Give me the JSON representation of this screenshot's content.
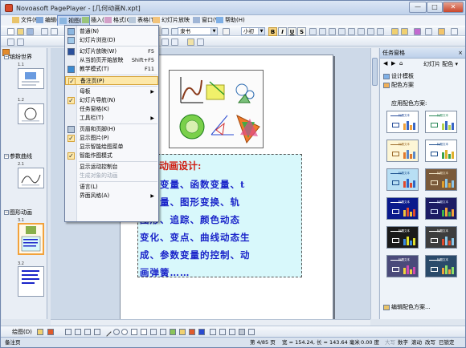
{
  "window": {
    "title": "Novoasoft PagePlayer - [几何动画N.xpt]",
    "minimize": "—",
    "maximize": "□",
    "close": "✕"
  },
  "menubar": [
    "文件(F)",
    "编辑(E)",
    "视图(V)",
    "插入(I)",
    "格式(O)",
    "表格(T)",
    "幻灯片放映",
    "窗口(W)",
    "帮助(H)"
  ],
  "format_bar": {
    "font_name": "隶书",
    "font_size": "小初",
    "bold": "B",
    "italic": "I",
    "underline": "U",
    "shadow": "S"
  },
  "view_menu": [
    {
      "label": "普通(N)",
      "icon": "normal-view-icon"
    },
    {
      "label": "幻灯片浏览(D)",
      "icon": "slide-sorter-icon"
    },
    {
      "label": "幻灯片放映(W)",
      "shortcut": "F5",
      "icon": "slideshow-icon"
    },
    {
      "label": "从当前页开始放映",
      "shortcut": "Shift+F5"
    },
    {
      "label": "教学模式(T)",
      "shortcut": "F11",
      "icon": "teaching-mode-icon"
    },
    {
      "label": "备注页(P)",
      "checked": true,
      "highlighted": true
    },
    {
      "label": "母板",
      "submenu": true
    },
    {
      "label": "幻灯片导航(N)",
      "checked": true
    },
    {
      "label": "任务窗格(K)"
    },
    {
      "label": "工具栏(T)",
      "submenu": true
    },
    {
      "label": "页眉和页脚(H)",
      "icon": "header-footer-icon"
    },
    {
      "label": "显示图片(P)",
      "checked": true
    },
    {
      "label": "显示智能绘图菜单"
    },
    {
      "label": "智能作图模式",
      "checked": true
    },
    {
      "label": "显示运动控制台"
    },
    {
      "label": "生成对象的动画",
      "disabled": true
    },
    {
      "label": "语言(L)"
    },
    {
      "label": "界面风格(A)",
      "submenu": true
    }
  ],
  "outline": {
    "sections": [
      {
        "label": "缤纷世界",
        "toggle": "−"
      },
      {
        "label": "参数曲线",
        "toggle": "−"
      },
      {
        "label": "图形动画",
        "toggle": "−"
      }
    ],
    "slides": [
      "1.1",
      "1.2",
      "2.1",
      "3.1",
      "3.2"
    ]
  },
  "slide": {
    "title": "形动画设计:",
    "lines": [
      "定义变量、函数变量、t",
      "形度量、图形变换、轨",
      "图形、追踪、颜色动态",
      "变化、变点、曲线动态生",
      "成、参数变量的控制、动",
      "画弹簧……"
    ]
  },
  "task_pane": {
    "title": "任务窗格",
    "close": "×",
    "current": "幻灯片 配色",
    "links": [
      "设计模板",
      "配色方案"
    ],
    "section_label": "应用配色方案:",
    "scheme_title": "标题文本",
    "schemes": [
      {
        "bg": "#ffffff",
        "accent": "#2a4f9b",
        "bar1": "#f2a23b",
        "bar2": "#3a67c5"
      },
      {
        "bg": "#ffffff",
        "accent": "#2d8a5b",
        "bar1": "#b5d44d",
        "bar2": "#3a67c5"
      },
      {
        "bg": "#fdf6d6",
        "accent": "#9b6a2a",
        "bar1": "#e07a2d",
        "bar2": "#5a88c9"
      },
      {
        "bg": "#ffffff",
        "accent": "#1f4f8e",
        "bar1": "#3aa34a",
        "bar2": "#e0b12d"
      },
      {
        "bg": "#b8dff4",
        "accent": "#1b4f8c",
        "bar1": "#e04a2d",
        "bar2": "#2d67c5"
      },
      {
        "bg": "#7a5a3a",
        "accent": "#f2e6c8",
        "bar1": "#e0a02d",
        "bar2": "#8cc6e8"
      },
      {
        "bg": "#0a1a8c",
        "accent": "#ffffff",
        "bar1": "#f2c23b",
        "bar2": "#e04a2d"
      },
      {
        "bg": "#1c1c64",
        "accent": "#dce8ff",
        "bar1": "#3ab34a",
        "bar2": "#f2a23b"
      },
      {
        "bg": "#1a1a1a",
        "accent": "#ffffff",
        "bar1": "#3a8ae0",
        "bar2": "#e0e02d"
      },
      {
        "bg": "#3d3d3d",
        "accent": "#ffffff",
        "bar1": "#e04a2d",
        "bar2": "#8cc6e8"
      },
      {
        "bg": "#4a4a7a",
        "accent": "#ffffff",
        "bar1": "#f2d23b",
        "bar2": "#d04ab0"
      },
      {
        "bg": "#2a4a6a",
        "accent": "#ffffff",
        "bar1": "#f2a23b",
        "bar2": "#8ce06a"
      }
    ],
    "edit_link": "编辑配色方案..."
  },
  "draw_bar": {
    "label": "绘图(D)"
  },
  "status_bar": {
    "left": "备注页",
    "page": "第 4/85 页",
    "dims": "宽 = 154.24, 长 = 143.64 毫米",
    "extra": "0.00 度",
    "caps": "大写",
    "num": "数字",
    "scrl": "滚动",
    "ovr": "改写",
    "rec": "已锁定"
  },
  "colors": {
    "accent": "#e38b2d",
    "slide_title": "#cf1c10",
    "slide_text": "#1a24c9",
    "textbox_fill": "#d8f8fb"
  }
}
